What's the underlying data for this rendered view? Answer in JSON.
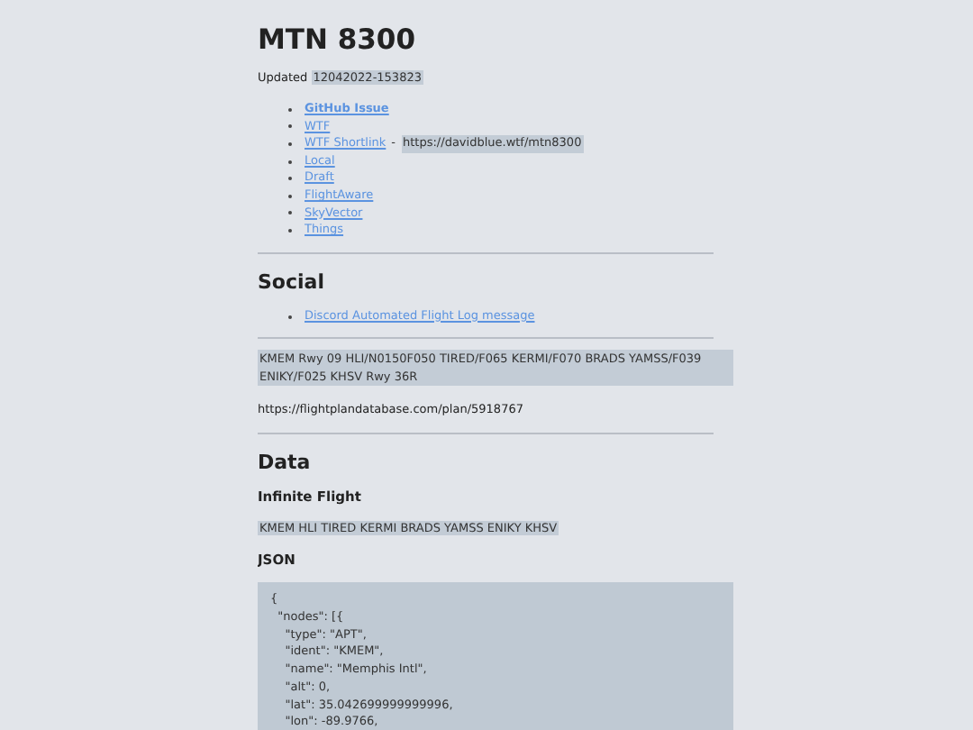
{
  "title": "MTN 8300",
  "updated": {
    "label": "Updated",
    "value": "12042022-153823"
  },
  "links": [
    {
      "label": "GitHub Issue",
      "bold": true
    },
    {
      "label": "WTF",
      "bold": false
    },
    {
      "label": "WTF Shortlink",
      "bold": false,
      "separator": "-",
      "suffix": "https://davidblue.wtf/mtn8300"
    },
    {
      "label": "Local",
      "bold": false
    },
    {
      "label": "Draft",
      "bold": false
    },
    {
      "label": "FlightAware",
      "bold": false
    },
    {
      "label": "SkyVector",
      "bold": false
    },
    {
      "label": "Things",
      "bold": false
    }
  ],
  "social": {
    "heading": "Social",
    "links": [
      {
        "label": "Discord Automated Flight Log message"
      }
    ]
  },
  "route": "KMEM Rwy 09 HLI/N0150F050 TIRED/F065 KERMI/F070 BRADS YAMSS/F039 ENIKY/F025 KHSV Rwy 36R",
  "plan_url": "https://flightplandatabase.com/plan/5918767",
  "data": {
    "heading": "Data",
    "infinite_flight": {
      "heading": "Infinite Flight",
      "route": "KMEM HLI TIRED KERMI BRADS YAMSS ENIKY KHSV"
    },
    "json": {
      "heading": "JSON",
      "lines": [
        "{",
        "  \"nodes\": [{",
        "    \"type\": \"APT\",",
        "    \"ident\": \"KMEM\",",
        "    \"name\": \"Memphis Intl\",",
        "    \"alt\": 0,",
        "    \"lat\": 35.042699999999996,",
        "    \"lon\": -89.9766,"
      ]
    }
  }
}
